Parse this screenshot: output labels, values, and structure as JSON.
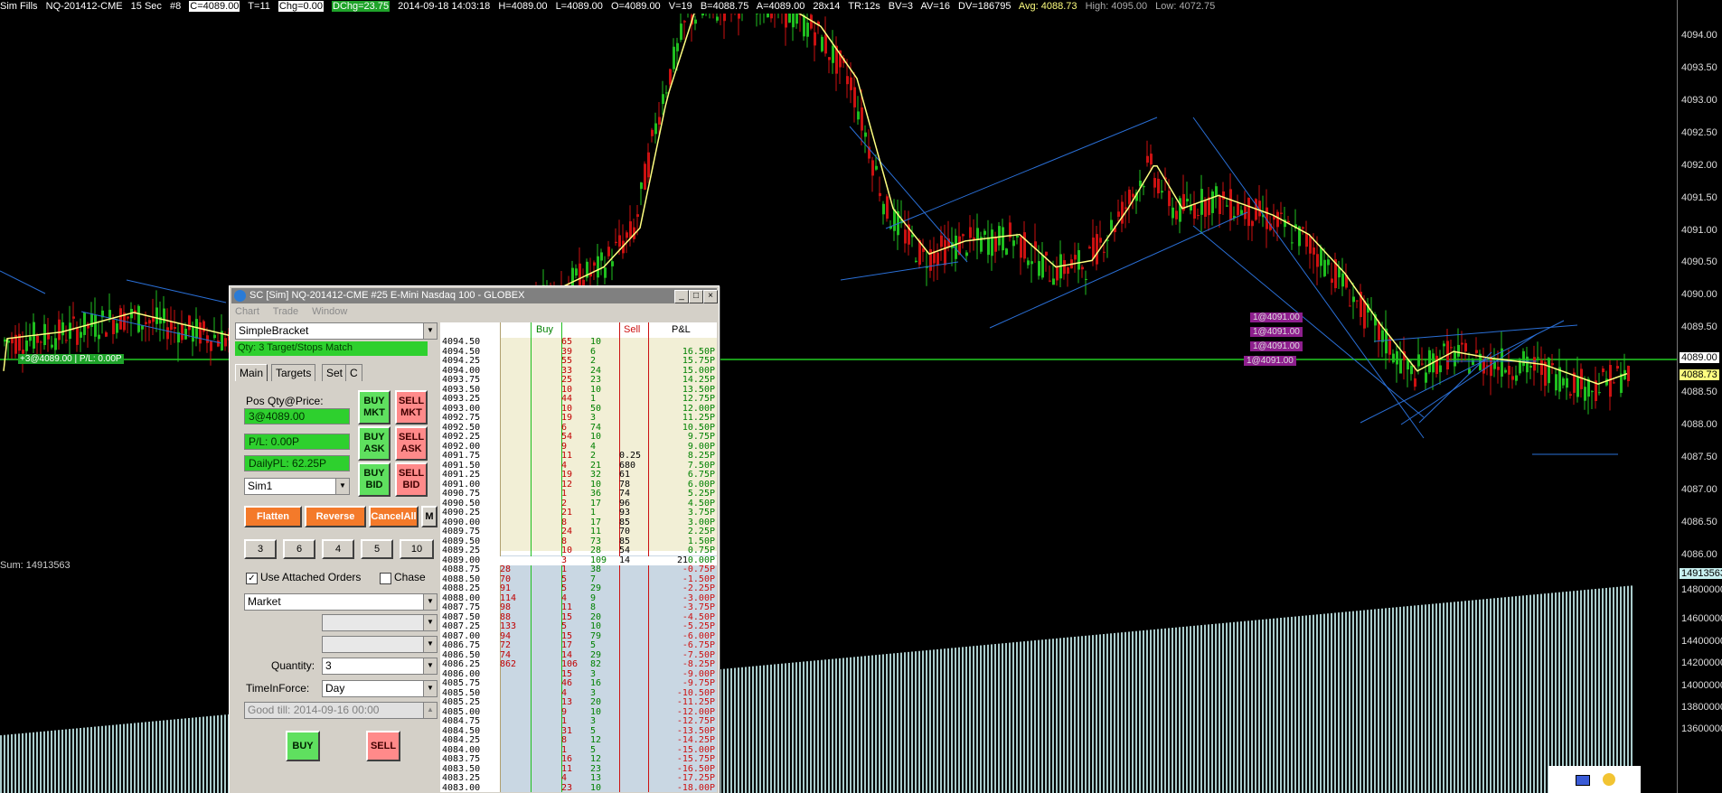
{
  "status_bar": {
    "chart_label": "Sim Fills",
    "symbol": "NQ-201412-CME",
    "interval": "15 Sec",
    "chart_num": "#8",
    "close": "C=4089.00",
    "trades": "T=11",
    "change": "Chg=0.00",
    "dchange": "DChg=23.75",
    "datetime": "2014-09-18 14:03:18",
    "high_bar": "H=4089.00",
    "low_bar": "L=4089.00",
    "open_bar": "O=4089.00",
    "volume": "V=19",
    "bid": "B=4088.75",
    "ask": "A=4089.00",
    "size": "28x14",
    "tr": "TR:12s",
    "bv": "BV=3",
    "av": "AV=16",
    "dv": "DV=186795",
    "avg": "Avg: 4088.73",
    "high": "High: 4095.00",
    "low": "Low: 4072.75"
  },
  "price_axis": {
    "labels": [
      "4094.00",
      "4093.50",
      "4093.00",
      "4092.50",
      "4092.00",
      "4091.50",
      "4091.00",
      "4090.50",
      "4090.00",
      "4089.50",
      "4088.50",
      "4088.00",
      "4087.50",
      "4087.00",
      "4086.50",
      "4086.00"
    ],
    "current_price": "4089.00",
    "avg_price": "4088.73",
    "volume_labels": [
      "14800000",
      "14600000",
      "14400000",
      "14200000",
      "14000000",
      "13800000",
      "13600000"
    ],
    "volume_current": "14913563"
  },
  "chart": {
    "sum_label": "Sum: 14913563",
    "position_label": "+3@4089.00 | P/L: 0.00P",
    "order_labels": [
      "1@4091.00",
      "1@4091.00",
      "1@4091.00",
      "1@4091.00"
    ]
  },
  "trade_window": {
    "title": "SC [Sim] NQ-201412-CME  #25  E-Mini Nasdaq 100 - GLOBEX",
    "menu": [
      "Chart",
      "Trade",
      "Window"
    ],
    "strategy": "SimpleBracket",
    "qty_info": "Qty: 3 Target/Stops Match",
    "tabs": [
      "Main",
      "Targets",
      "Set",
      "C"
    ],
    "pos_label": "Pos Qty@Price:",
    "pos_value": "3@4089.00",
    "pl_value": "P/L: 0.00P",
    "daily_pl": "DailyPL: 62.25P",
    "account": "Sim1",
    "buy_mkt": "BUY MKT",
    "sell_mkt": "SELL MKT",
    "buy_ask": "BUY ASK",
    "sell_ask": "SELL ASK",
    "buy_bid": "BUY BID",
    "sell_bid": "SELL BID",
    "flatten": "Flatten",
    "reverse": "Reverse",
    "cancel_all": "CancelAll",
    "m_label": "M",
    "qty_buttons": [
      "3",
      "6",
      "4",
      "5",
      "10"
    ],
    "use_attached": "Use Attached Orders",
    "chase": "Chase",
    "order_type": "Market",
    "quantity_label": "Quantity:",
    "quantity": "3",
    "tif_label": "TimeInForce:",
    "tif": "Day",
    "good_till": "Good till: 2014-09-16 00:00",
    "buy": "BUY",
    "sell": "SELL"
  },
  "ladder": {
    "headers": {
      "buy": "Buy",
      "sell": "Sell",
      "pl": "P&L"
    },
    "last_price": "4089.00",
    "rows": [
      {
        "price": "4094.50",
        "bid": "",
        "buy": "",
        "askv": "65",
        "bidv": "10",
        "sell": "",
        "pl": ""
      },
      {
        "price": "4094.50",
        "bid": "",
        "buy": "",
        "askv": "39",
        "bidv": "6",
        "sell": "",
        "pl": "16.50P"
      },
      {
        "price": "4094.25",
        "bid": "",
        "buy": "",
        "askv": "55",
        "bidv": "2",
        "sell": "",
        "pl": "15.75P"
      },
      {
        "price": "4094.00",
        "bid": "",
        "buy": "",
        "askv": "33",
        "bidv": "24",
        "sell": "",
        "pl": "15.00P"
      },
      {
        "price": "4093.75",
        "bid": "",
        "buy": "",
        "askv": "25",
        "bidv": "23",
        "sell": "",
        "pl": "14.25P"
      },
      {
        "price": "4093.50",
        "bid": "",
        "buy": "",
        "askv": "10",
        "bidv": "10",
        "sell": "",
        "pl": "13.50P"
      },
      {
        "price": "4093.25",
        "bid": "",
        "buy": "",
        "askv": "44",
        "bidv": "1",
        "sell": "",
        "pl": "12.75P"
      },
      {
        "price": "4093.00",
        "bid": "",
        "buy": "",
        "askv": "10",
        "bidv": "50",
        "sell": "",
        "pl": "12.00P"
      },
      {
        "price": "4092.75",
        "bid": "",
        "buy": "",
        "askv": "19",
        "bidv": "3",
        "sell": "",
        "pl": "11.25P"
      },
      {
        "price": "4092.50",
        "bid": "",
        "buy": "",
        "askv": "6",
        "bidv": "74",
        "sell": "",
        "pl": "10.50P"
      },
      {
        "price": "4092.25",
        "bid": "",
        "buy": "",
        "askv": "54",
        "bidv": "10",
        "sell": "",
        "pl": "9.75P"
      },
      {
        "price": "4092.00",
        "bid": "",
        "buy": "",
        "askv": "9",
        "bidv": "4",
        "sell": "",
        "pl": "9.00P"
      },
      {
        "price": "4091.75",
        "bid": "",
        "buy": "",
        "askv": "11",
        "bidv": "2",
        "sell": "0.25",
        "pl": "8.25P"
      },
      {
        "price": "4091.50",
        "bid": "",
        "buy": "",
        "askv": "4",
        "bidv": "21",
        "sell": "680",
        "pl": "7.50P"
      },
      {
        "price": "4091.25",
        "bid": "",
        "buy": "",
        "askv": "19",
        "bidv": "32",
        "sell": "61",
        "pl": "6.75P"
      },
      {
        "price": "4091.00",
        "bid": "",
        "buy": "",
        "askv": "12",
        "bidv": "10",
        "sell": "78",
        "pl": "6.00P"
      },
      {
        "price": "4090.75",
        "bid": "",
        "buy": "",
        "askv": "1",
        "bidv": "36",
        "sell": "74",
        "pl": "5.25P"
      },
      {
        "price": "4090.50",
        "bid": "",
        "buy": "",
        "askv": "2",
        "bidv": "17",
        "sell": "96",
        "pl": "4.50P"
      },
      {
        "price": "4090.25",
        "bid": "",
        "buy": "",
        "askv": "21",
        "bidv": "1",
        "sell": "93",
        "pl": "3.75P"
      },
      {
        "price": "4090.00",
        "bid": "",
        "buy": "",
        "askv": "8",
        "bidv": "17",
        "sell": "85",
        "pl": "3.00P"
      },
      {
        "price": "4089.75",
        "bid": "",
        "buy": "",
        "askv": "24",
        "bidv": "11",
        "sell": "70",
        "pl": "2.25P"
      },
      {
        "price": "4089.50",
        "bid": "",
        "buy": "",
        "askv": "8",
        "bidv": "73",
        "sell": "85",
        "pl": "1.50P"
      },
      {
        "price": "4089.25",
        "bid": "",
        "buy": "",
        "askv": "10",
        "bidv": "28",
        "sell": "54",
        "pl": "0.75P"
      },
      {
        "price": "4089.00",
        "bid": "",
        "buy": "",
        "askv": "3",
        "bidv": "109",
        "sell": "14",
        "extra": "21",
        "pl": "0.00P"
      },
      {
        "price": "4088.75",
        "bid": "28",
        "buy": "",
        "askv": "1",
        "bidv": "38",
        "sell": "",
        "pl": "-0.75P"
      },
      {
        "price": "4088.50",
        "bid": "70",
        "buy": "",
        "askv": "5",
        "bidv": "7",
        "sell": "",
        "pl": "-1.50P"
      },
      {
        "price": "4088.25",
        "bid": "91",
        "buy": "",
        "askv": "5",
        "bidv": "29",
        "sell": "",
        "pl": "-2.25P"
      },
      {
        "price": "4088.00",
        "bid": "114",
        "buy": "",
        "askv": "4",
        "bidv": "9",
        "sell": "",
        "pl": "-3.00P"
      },
      {
        "price": "4087.75",
        "bid": "98",
        "buy": "",
        "askv": "11",
        "bidv": "8",
        "sell": "",
        "pl": "-3.75P"
      },
      {
        "price": "4087.50",
        "bid": "88",
        "buy": "",
        "askv": "15",
        "bidv": "20",
        "sell": "",
        "pl": "-4.50P"
      },
      {
        "price": "4087.25",
        "bid": "133",
        "buy": "",
        "askv": "5",
        "bidv": "10",
        "sell": "",
        "pl": "-5.25P"
      },
      {
        "price": "4087.00",
        "bid": "94",
        "buy": "",
        "askv": "15",
        "bidv": "79",
        "sell": "",
        "pl": "-6.00P"
      },
      {
        "price": "4086.75",
        "bid": "72",
        "buy": "",
        "askv": "17",
        "bidv": "5",
        "sell": "",
        "pl": "-6.75P"
      },
      {
        "price": "4086.50",
        "bid": "74",
        "buy": "",
        "askv": "14",
        "bidv": "29",
        "sell": "",
        "pl": "-7.50P"
      },
      {
        "price": "4086.25",
        "bid": "862",
        "buy": "",
        "askv": "106",
        "bidv": "82",
        "sell": "",
        "pl": "-8.25P"
      },
      {
        "price": "4086.00",
        "bid": "",
        "buy": "",
        "askv": "15",
        "bidv": "3",
        "sell": "",
        "pl": "-9.00P"
      },
      {
        "price": "4085.75",
        "bid": "",
        "buy": "",
        "askv": "46",
        "bidv": "16",
        "sell": "",
        "pl": "-9.75P"
      },
      {
        "price": "4085.50",
        "bid": "",
        "buy": "",
        "askv": "4",
        "bidv": "3",
        "sell": "",
        "pl": "-10.50P"
      },
      {
        "price": "4085.25",
        "bid": "",
        "buy": "",
        "askv": "13",
        "bidv": "20",
        "sell": "",
        "pl": "-11.25P"
      },
      {
        "price": "4085.00",
        "bid": "",
        "buy": "",
        "askv": "9",
        "bidv": "10",
        "sell": "",
        "pl": "-12.00P"
      },
      {
        "price": "4084.75",
        "bid": "",
        "buy": "",
        "askv": "1",
        "bidv": "3",
        "sell": "",
        "pl": "-12.75P"
      },
      {
        "price": "4084.50",
        "bid": "",
        "buy": "",
        "askv": "31",
        "bidv": "5",
        "sell": "",
        "pl": "-13.50P"
      },
      {
        "price": "4084.25",
        "bid": "",
        "buy": "",
        "askv": "8",
        "bidv": "12",
        "sell": "",
        "pl": "-14.25P"
      },
      {
        "price": "4084.00",
        "bid": "",
        "buy": "",
        "askv": "1",
        "bidv": "5",
        "sell": "",
        "pl": "-15.00P"
      },
      {
        "price": "4083.75",
        "bid": "",
        "buy": "",
        "askv": "16",
        "bidv": "12",
        "sell": "",
        "pl": "-15.75P"
      },
      {
        "price": "4083.50",
        "bid": "",
        "buy": "",
        "askv": "11",
        "bidv": "23",
        "sell": "",
        "pl": "-16.50P"
      },
      {
        "price": "4083.25",
        "bid": "",
        "buy": "",
        "askv": "4",
        "bidv": "13",
        "sell": "",
        "pl": "-17.25P"
      },
      {
        "price": "4083.00",
        "bid": "",
        "buy": "",
        "askv": "23",
        "bidv": "10",
        "sell": "",
        "pl": "-18.00P"
      }
    ]
  },
  "colors": {
    "background": "#000000",
    "bull": "#1fbf1f",
    "bear": "#cc1111",
    "ma": "#ffff80",
    "trendline": "#2a6fd6",
    "price_line": "#22cc22",
    "volume": "#c8f0f0",
    "ladder_ask": "#f2efd6",
    "ladder_bid": "#c9d7e3"
  },
  "icons": [
    "globe-icon",
    "minimize-icon",
    "maximize-icon",
    "close-icon",
    "dropdown-arrow-icon",
    "tray-icon"
  ]
}
